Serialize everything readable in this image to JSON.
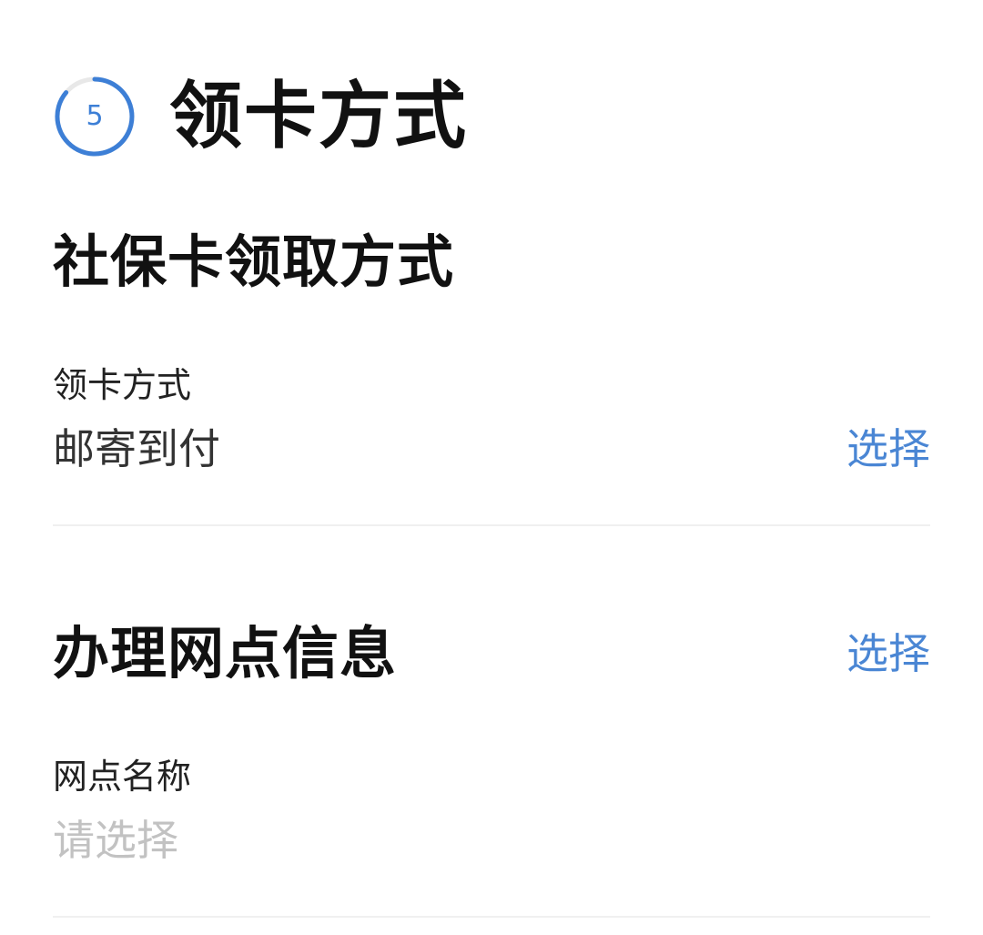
{
  "step": {
    "number": "5",
    "title": "领卡方式",
    "accent_color": "#3d7fd6",
    "ring_icon": "progress-ring-icon"
  },
  "card_pickup": {
    "section_title": "社保卡领取方式",
    "field_label": "领卡方式",
    "field_value": "邮寄到付",
    "action_label": "选择"
  },
  "outlet_info": {
    "section_title": "办理网点信息",
    "action_label": "选择",
    "field_label": "网点名称",
    "field_placeholder": "请选择"
  },
  "colors": {
    "link": "#4a86d4",
    "placeholder": "#c2c2c2",
    "divider": "#f0f0f0"
  }
}
